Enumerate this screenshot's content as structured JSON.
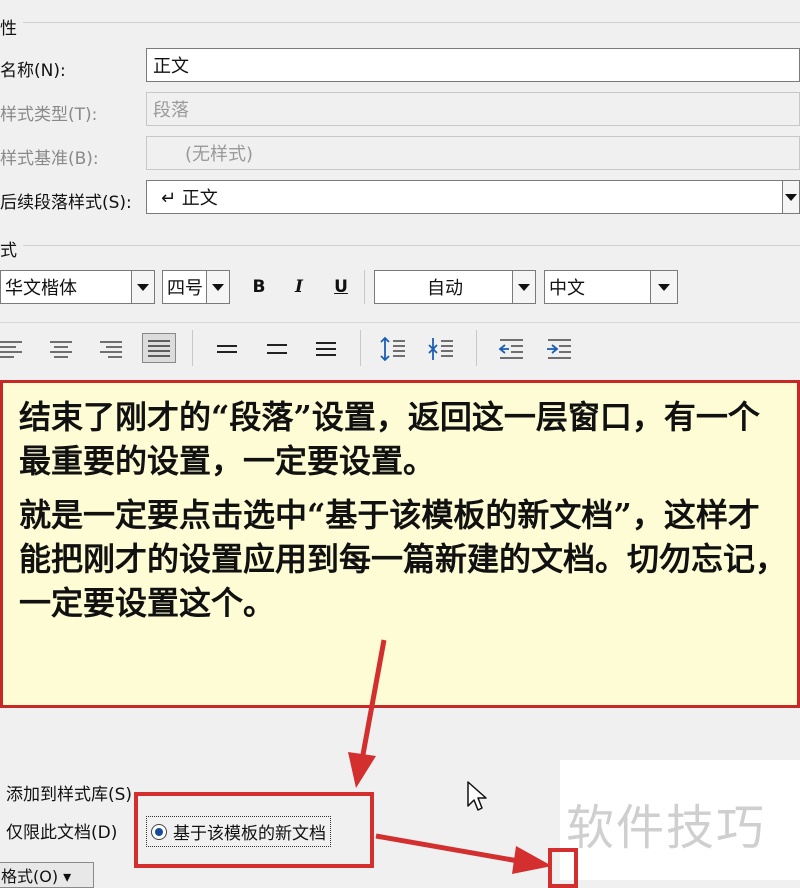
{
  "properties": {
    "section_label": "性",
    "name_label": "名称(N):",
    "name_value": "正文",
    "type_label": "样式类型(T):",
    "type_value": "段落",
    "base_label": "样式基准(B):",
    "base_value": "(无样式)",
    "next_label": "后续段落样式(S):",
    "next_value": "↵ 正文"
  },
  "format": {
    "section_label": "式",
    "font": "华文楷体",
    "size": "四号",
    "bold": "B",
    "italic": "I",
    "underline": "U",
    "color": "自动",
    "script": "中文"
  },
  "callout": {
    "para1": "结束了刚才的“段落”设置，返回这一层窗口，有一个最重要的设置，一定要设置。",
    "para2": "就是一定要点击选中“基于该模板的新文档”，这样才能把刚才的设置应用到每一篇新建的文档。切勿忘记，一定要设置这个。"
  },
  "options": {
    "add_to_gallery": "添加到样式库(S)",
    "only_this_doc": "仅限此文档(D)",
    "new_docs_template": "基于该模板的新文档",
    "format_button": "格式(O) ▾"
  },
  "watermark": "软件技巧",
  "colors": {
    "accent_red": "#d32f2f",
    "callout_bg": "#fdfcd5"
  }
}
